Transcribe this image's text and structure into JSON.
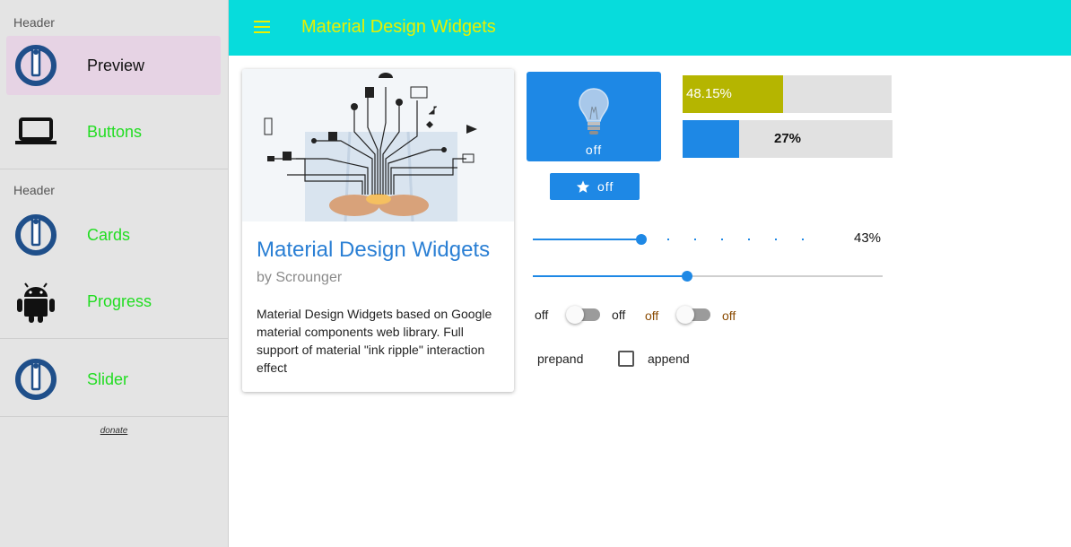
{
  "sidebar": {
    "header1": "Header",
    "header2": "Header",
    "items": [
      {
        "label": "Preview",
        "icon": "iobroker-logo-icon",
        "active": true
      },
      {
        "label": "Buttons",
        "icon": "laptop-icon"
      },
      {
        "label": "Cards",
        "icon": "iobroker-logo-icon"
      },
      {
        "label": "Progress",
        "icon": "android-icon"
      },
      {
        "label": "Slider",
        "icon": "iobroker-logo-icon"
      }
    ],
    "donate": "donate"
  },
  "topbar": {
    "title": "Material Design Widgets",
    "menu_icon": "hamburger-menu-icon",
    "background": "#07dcdc",
    "title_color": "#e8f000"
  },
  "card": {
    "title": "Material Design Widgets",
    "subtitle": "by Scrounger",
    "text": "Material Design Widgets based on Google material components web library. Full support of material \"ink ripple\" interaction effect"
  },
  "light": {
    "state": "off",
    "icon": "lightbulb-icon",
    "color": "#1e88e5"
  },
  "star_button": {
    "label": "off",
    "icon": "star-icon"
  },
  "progress": [
    {
      "label": "48.15%",
      "value": 48.15,
      "color": "#b5b500"
    },
    {
      "label": "27%",
      "value": 27,
      "color": "#1e88e5"
    }
  ],
  "sliders": [
    {
      "value": 40,
      "label": "43%",
      "discrete": true
    },
    {
      "value": 44
    }
  ],
  "switches": [
    {
      "left_label": "off",
      "right_label": "off",
      "label_color": "#222222"
    },
    {
      "left_label": "off",
      "right_label": "off",
      "label_color": "#8a4a00"
    }
  ],
  "checkbox": {
    "prepend": "prepand",
    "append": "append",
    "checked": false
  }
}
